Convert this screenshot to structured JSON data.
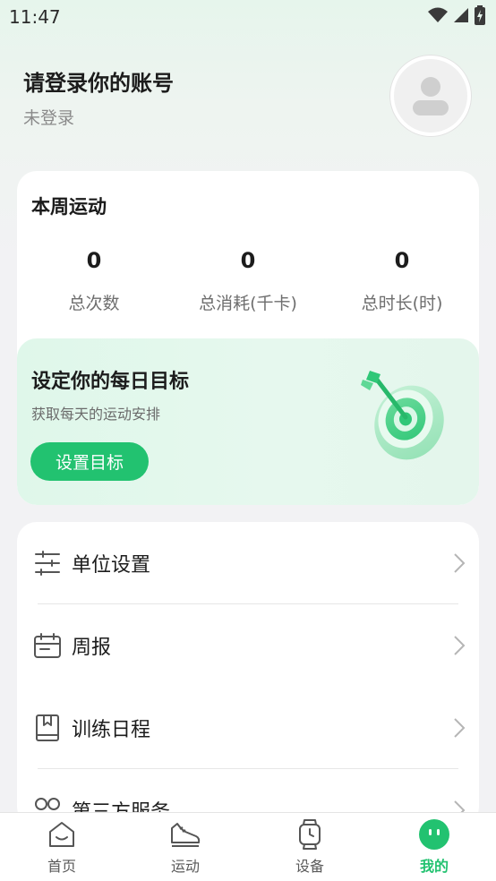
{
  "status_bar": {
    "time": "11:47",
    "icons": [
      "wifi-icon",
      "signal-icon",
      "battery-icon"
    ]
  },
  "profile": {
    "title": "请登录你的账号",
    "subtitle": "未登录",
    "avatar_icon": "user-avatar-icon"
  },
  "weekly": {
    "title": "本周运动",
    "stats": [
      {
        "value": "0",
        "label": "总次数"
      },
      {
        "value": "0",
        "label": "总消耗(千卡)"
      },
      {
        "value": "0",
        "label": "总时长(时)"
      }
    ]
  },
  "goal": {
    "title": "设定你的每日目标",
    "subtitle": "获取每天的运动安排",
    "button_label": "设置目标",
    "art_icon": "target-dart-icon"
  },
  "menu": {
    "items": [
      {
        "label": "单位设置",
        "icon": "sliders-icon"
      },
      {
        "label": "周报",
        "icon": "calendar-icon"
      },
      {
        "label": "训练日程",
        "icon": "book-icon"
      },
      {
        "label": "第三方服务",
        "icon": "link-icon"
      }
    ]
  },
  "tabbar": {
    "tabs": [
      {
        "label": "首页",
        "icon": "home-icon",
        "active": false
      },
      {
        "label": "运动",
        "icon": "sneaker-icon",
        "active": false
      },
      {
        "label": "设备",
        "icon": "watch-icon",
        "active": false
      },
      {
        "label": "我的",
        "icon": "profile-face-icon",
        "active": true
      }
    ]
  },
  "colors": {
    "accent": "#22c270",
    "header_bg": "#e6f5ec",
    "page_bg": "#f2f2f4",
    "text_secondary": "#8a8a8a"
  }
}
